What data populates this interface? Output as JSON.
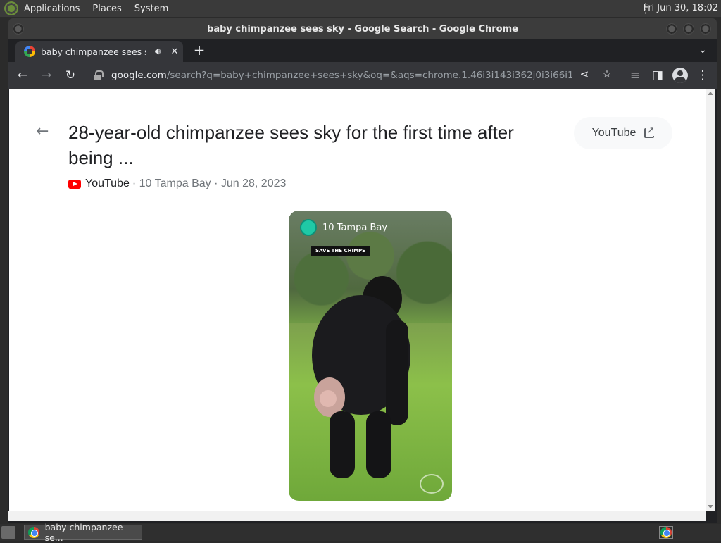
{
  "system_panel": {
    "menus": [
      "Applications",
      "Places",
      "System"
    ],
    "clock": "Fri Jun 30, 18:02"
  },
  "window": {
    "title": "baby chimpanzee sees sky - Google Search - Google Chrome"
  },
  "tab": {
    "title": "baby chimpanzee sees sky"
  },
  "toolbar": {
    "url_host": "google.com",
    "url_rest": "/search?q=baby+chimpanzee+sees+sky&oq=&aqs=chrome.1.46i3i143i362j0i3i66i143i362j46..."
  },
  "result": {
    "title": "28-year-old chimpanzee sees sky for the first time after being ...",
    "source": "YouTube",
    "meta": "· 10 Tampa Bay · Jun 28, 2023",
    "source_button": "YouTube"
  },
  "video": {
    "channel": "10 Tampa Bay",
    "label": "SAVE THE CHIMPS"
  },
  "taskbar": {
    "item": "baby chimpanzee se..."
  },
  "colors": {
    "chrome_dark": "#35363a",
    "youtube_red": "#ff0000",
    "text_primary": "#202124",
    "text_secondary": "#70757a"
  }
}
